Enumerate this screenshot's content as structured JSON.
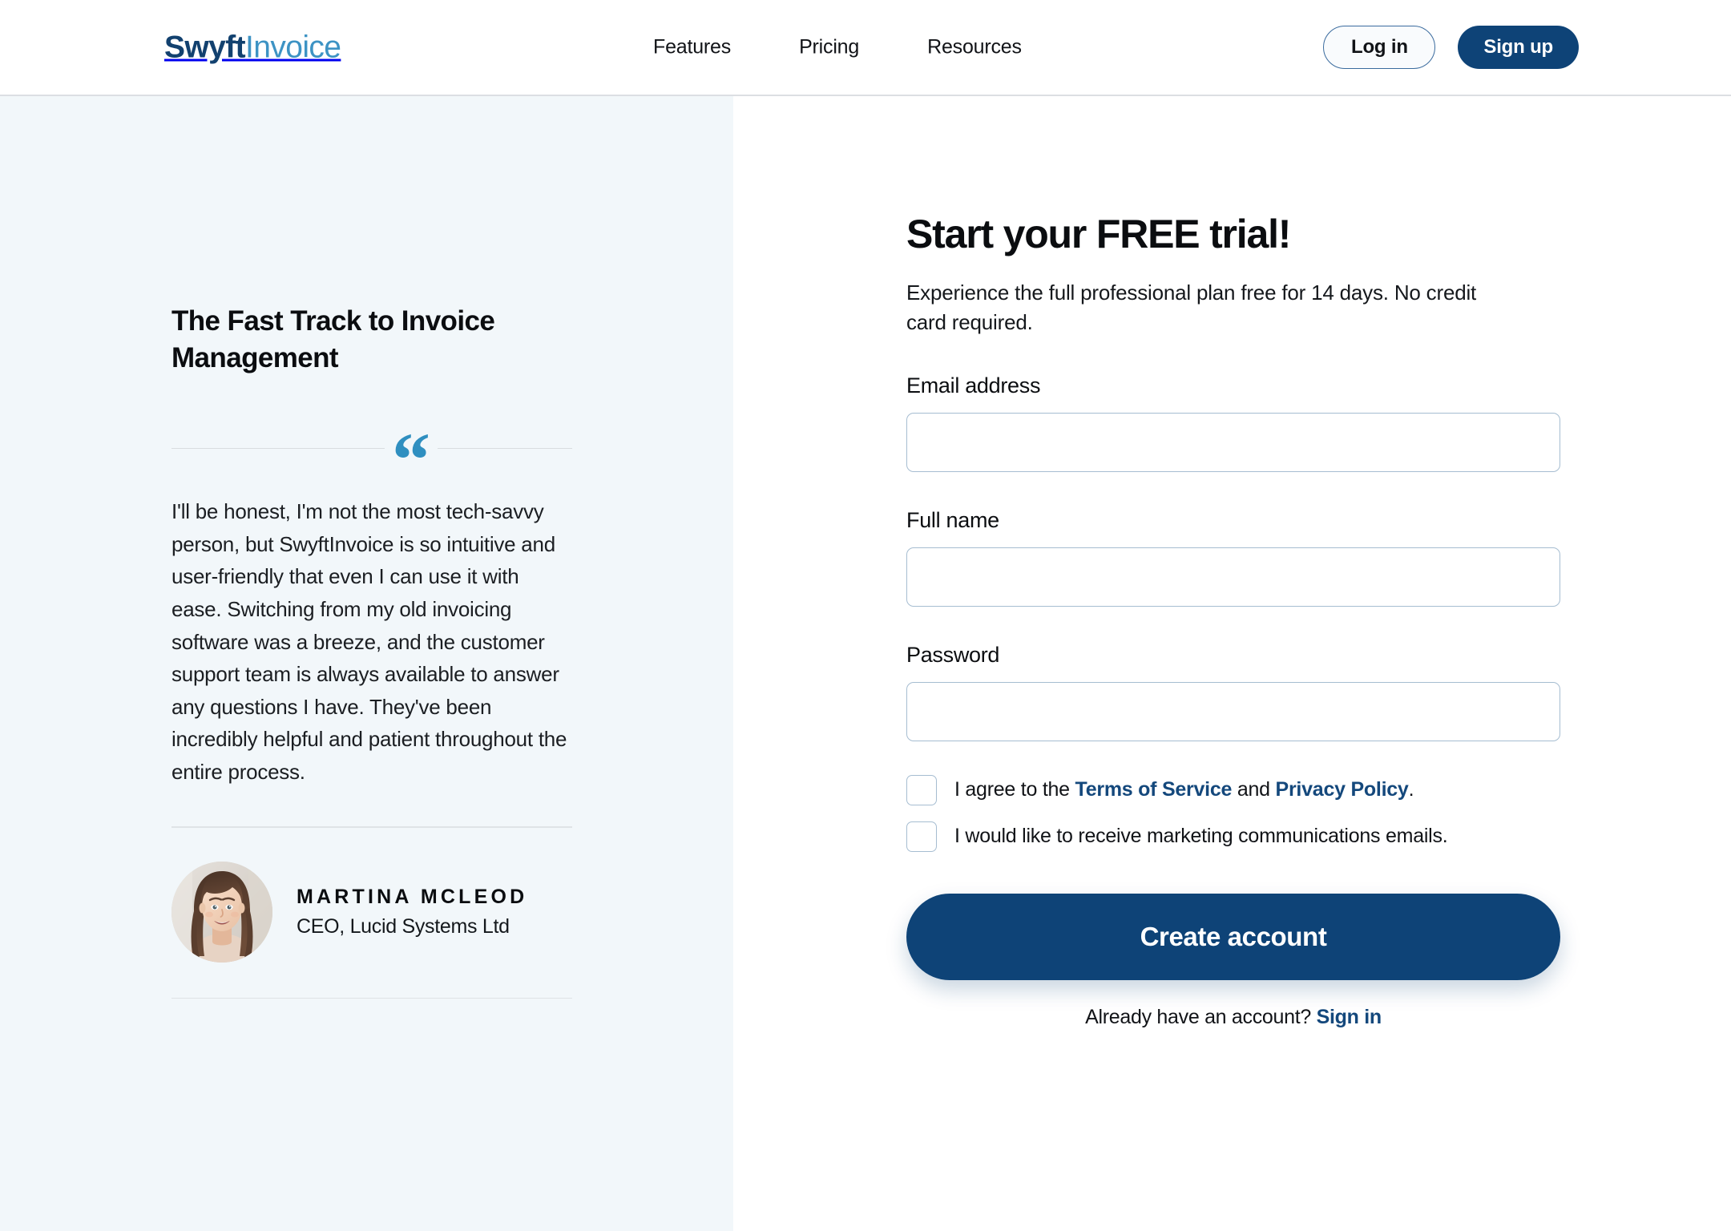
{
  "brand": {
    "logo_primary": "Swyft",
    "logo_secondary": "Invoice",
    "navy": "#0e4377",
    "light_blue": "#3d93c4",
    "panel_bg": "#f2f7fa"
  },
  "header": {
    "nav": [
      {
        "label": "Features"
      },
      {
        "label": "Pricing"
      },
      {
        "label": "Resources"
      }
    ],
    "login_label": "Log in",
    "signup_label": "Sign up"
  },
  "testimonial": {
    "title": "The Fast Track to Invoice Management",
    "quote_mark": "“",
    "quote": "I'll be honest, I'm not the most tech-savvy person, but SwyftInvoice is so intuitive and user-friendly that even I can use it with ease. Switching from my old invoicing software was a breeze, and the customer support team is always available to answer any questions I have. They've been incredibly helpful and patient throughout the entire process.",
    "author_name": "MARTINA MCLEOD",
    "author_role": "CEO, Lucid Systems Ltd",
    "avatar_alt": "Portrait of Martina McLeod"
  },
  "signup": {
    "title": "Start your FREE trial!",
    "subtitle": "Experience the full professional plan free for 14 days. No credit card required.",
    "fields": [
      {
        "label": "Email address",
        "value": "",
        "placeholder": "",
        "type": "email"
      },
      {
        "label": "Full name",
        "value": "",
        "placeholder": "",
        "type": "text"
      },
      {
        "label": "Password",
        "value": "",
        "placeholder": "",
        "type": "password"
      }
    ],
    "consents": [
      {
        "checked": false,
        "prefix": "I agree to the ",
        "link1": "Terms of Service",
        "middle": " and ",
        "link2": "Privacy Policy",
        "suffix": "."
      },
      {
        "checked": false,
        "prefix": "I would like to receive marketing communications emails.",
        "link1": "",
        "middle": "",
        "link2": "",
        "suffix": ""
      }
    ],
    "submit_label": "Create account",
    "signin_prompt": "Already have an account? ",
    "signin_link": "Sign in"
  }
}
